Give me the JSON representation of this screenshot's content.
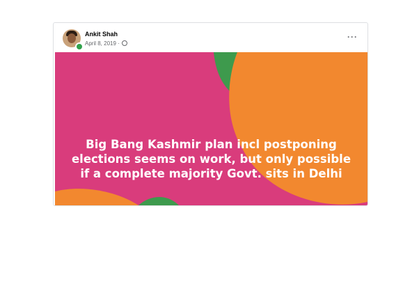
{
  "post": {
    "author": "Ankit Shah",
    "date": "April 8, 2019 ·",
    "privacy_icon": "globe-icon",
    "more_label": "···",
    "text_lines": [
      "Big Bang Kashmir plan incl postponing",
      "elections seems on work, but only possible",
      "if a complete majority Govt. sits in Delhi"
    ]
  },
  "colors": {
    "background_pink": "#d93c7c",
    "fruit_orange": "#f2882f",
    "leaf_green": "#3e9a4d",
    "text_white": "#ffffff"
  }
}
